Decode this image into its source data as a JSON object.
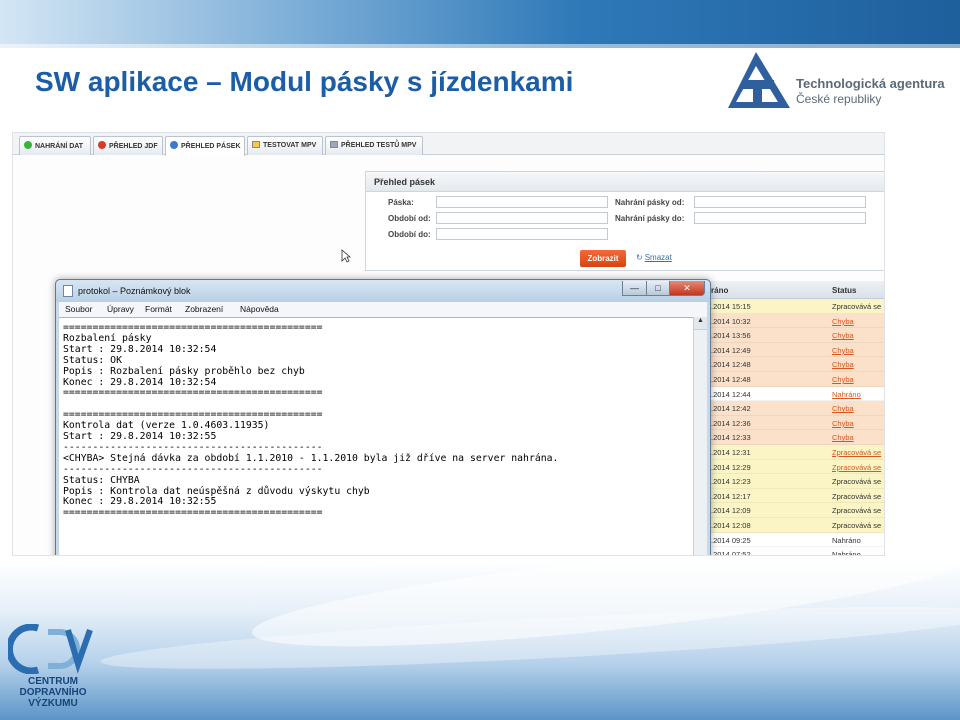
{
  "slide": {
    "title": "SW aplikace – Modul pásky s jízdenkami",
    "ta_logo_line1": "Technologická agentura",
    "ta_logo_line2": "České republiky",
    "cdv_lines": [
      "CENTRUM",
      "DOPRAVNÍHO",
      "VÝZKUMU"
    ]
  },
  "app": {
    "tabs": [
      {
        "label": "NAHRÁNÍ DAT",
        "icon": "green-circle-icon",
        "color": "#3bb33b"
      },
      {
        "label": "PŘEHLED JDF",
        "icon": "red-circle-icon",
        "color": "#d93a2a"
      },
      {
        "label": "PŘEHLED PÁSEK",
        "icon": "blue-circle-icon",
        "color": "#3a7ad0",
        "active": true
      },
      {
        "label": "TESTOVAT MPV",
        "icon": "yellow-folder-icon",
        "color": "#f2c94c"
      },
      {
        "label": "PŘEHLED TESTŮ MPV",
        "icon": "table-icon",
        "color": "#9aa9bd"
      }
    ],
    "filter": {
      "title": "Přehled pásek",
      "paska_label": "Páska:",
      "obdobi_od_label": "Období od:",
      "obdobi_do_label": "Období do:",
      "nahrani_od_label": "Nahrání pásky od:",
      "nahrani_do_label": "Nahrání pásky do:",
      "show_button": "Zobrazit",
      "delete_link": "Smazat"
    },
    "grid": {
      "col_date": "ráno",
      "col_status": "Status",
      "rows": [
        {
          "date": ".2014 15:15",
          "status": "Zpracovává se",
          "bg": "#fbf5c6",
          "link": false,
          "color": "#333333"
        },
        {
          "date": ".2014 10:32",
          "status": "Chyba",
          "bg": "#fbe1c9",
          "link": true,
          "color": "#d9561e"
        },
        {
          "date": ".2014 13:56",
          "status": "Chyba",
          "bg": "#fbe1c9",
          "link": true,
          "color": "#d9561e"
        },
        {
          "date": ".2014 12:49",
          "status": "Chyba",
          "bg": "#fbe1c9",
          "link": true,
          "color": "#d9561e"
        },
        {
          "date": ".2014 12:48",
          "status": "Chyba",
          "bg": "#fbe1c9",
          "link": true,
          "color": "#d9561e"
        },
        {
          "date": ".2014 12:48",
          "status": "Chyba",
          "bg": "#fbe1c9",
          "link": true,
          "color": "#d9561e"
        },
        {
          "date": ".2014 12:44",
          "status": "Nahráno",
          "bg": "#ffffff",
          "link": true,
          "color": "#d9561e"
        },
        {
          "date": ".2014 12:42",
          "status": "Chyba",
          "bg": "#fbe1c9",
          "link": true,
          "color": "#d9561e"
        },
        {
          "date": ".2014 12:36",
          "status": "Chyba",
          "bg": "#fbe1c9",
          "link": true,
          "color": "#d9561e"
        },
        {
          "date": ".2014 12:33",
          "status": "Chyba",
          "bg": "#fbe1c9",
          "link": true,
          "color": "#d9561e"
        },
        {
          "date": ".2014 12:31",
          "status": "Zpracovává se",
          "bg": "#fbf5c6",
          "link": true,
          "color": "#d9561e"
        },
        {
          "date": ".2014 12:29",
          "status": "Zpracovává se",
          "bg": "#fbf5c6",
          "link": true,
          "color": "#d9561e"
        },
        {
          "date": ".2014 12:23",
          "status": "Zpracovává se",
          "bg": "#fbf5c6",
          "link": false,
          "color": "#333333"
        },
        {
          "date": ".2014 12:17",
          "status": "Zpracovává se",
          "bg": "#fbf5c6",
          "link": false,
          "color": "#333333"
        },
        {
          "date": ".2014 12:09",
          "status": "Zpracovává se",
          "bg": "#fbf5c6",
          "link": false,
          "color": "#333333"
        },
        {
          "date": ".2014 12:08",
          "status": "Zpracovává se",
          "bg": "#fbf5c6",
          "link": false,
          "color": "#333333"
        },
        {
          "date": ".2014 09:25",
          "status": "Nahráno",
          "bg": "#ffffff",
          "link": false,
          "color": "#333333"
        },
        {
          "date": ".2014 07:52",
          "status": "Nahráno",
          "bg": "#ffffff",
          "link": false,
          "color": "#333333"
        }
      ]
    }
  },
  "notepad": {
    "title": "protokol – Poznámkový blok",
    "menu": [
      "Soubor",
      "Úpravy",
      "Formát",
      "Zobrazení",
      "Nápověda"
    ],
    "lines": [
      "============================================",
      "Rozbalení pásky",
      "Start : 29.8.2014 10:32:54",
      "Status: OK",
      "Popis : Rozbalení pásky proběhlo bez chyb",
      "Konec : 29.8.2014 10:32:54",
      "============================================",
      "",
      "============================================",
      "Kontrola dat (verze 1.0.4603.11935)",
      "Start : 29.8.2014 10:32:55",
      "--------------------------------------------",
      "<CHYBA> Stejná dávka za období 1.1.2010 - 1.1.2010 byla již dříve na server nahrána.",
      "--------------------------------------------",
      "Status: CHYBA",
      "Popis : Kontrola dat neúspěšná z důvodu výskytu chyb",
      "Konec : 29.8.2014 10:32:55",
      "============================================"
    ]
  }
}
